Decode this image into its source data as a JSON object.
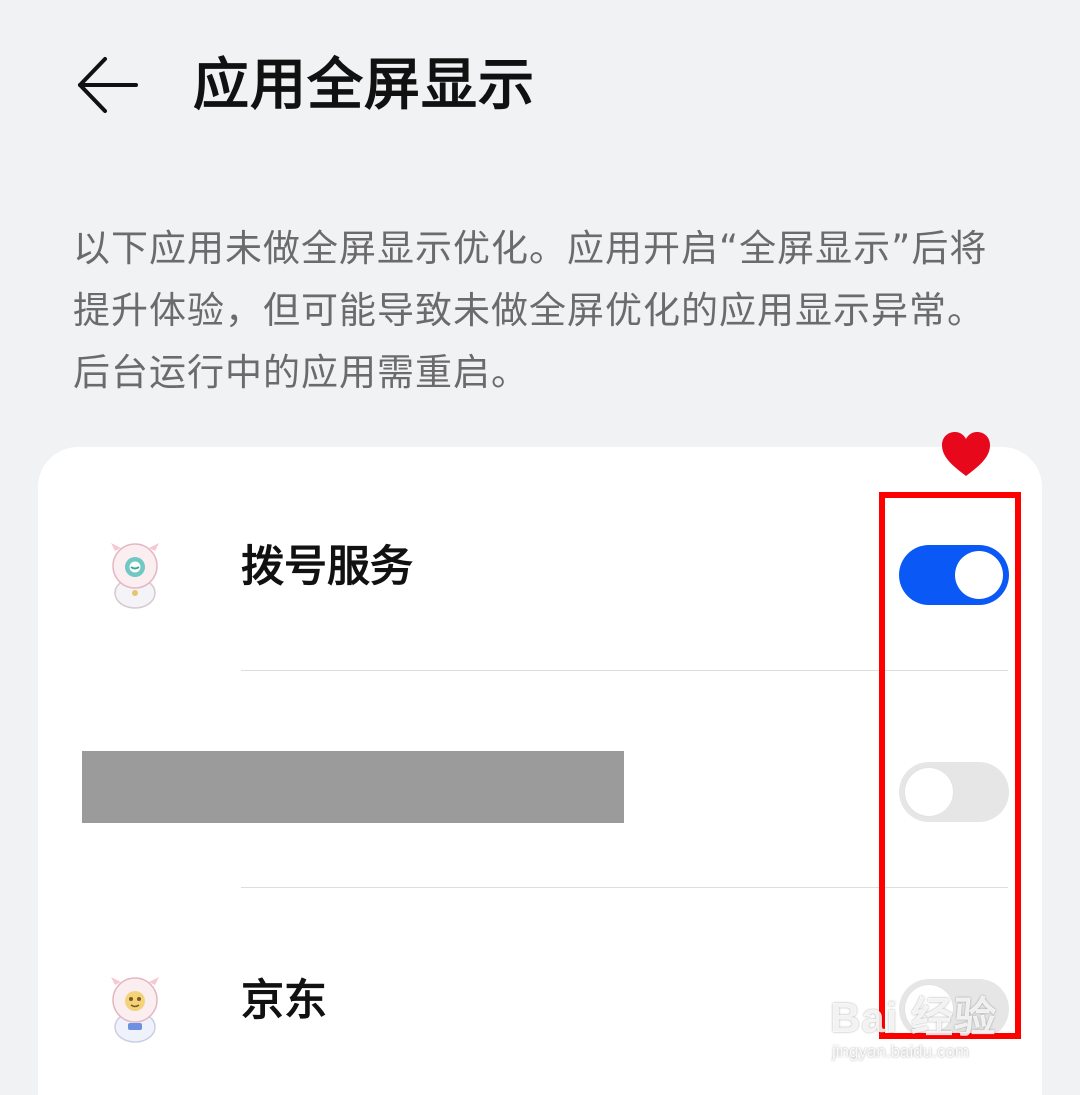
{
  "header": {
    "title": "应用全屏显示",
    "back_icon": "arrow-left-icon"
  },
  "description": "以下应用未做全屏显示优化。应用开启“全屏显示”后将提升体验，但可能导致未做全屏优化的应用显示异常。后台运行中的应用需重启。",
  "apps": [
    {
      "name": "拨号服务",
      "icon": "app-icon-dialer",
      "fullscreen_enabled": true
    },
    {
      "name": "",
      "icon": "redacted-block",
      "fullscreen_enabled": false
    },
    {
      "name": "京东",
      "icon": "app-icon-jd",
      "fullscreen_enabled": false
    }
  ],
  "annotation": {
    "box_color": "#ff0000",
    "marker_icon": "heart-icon"
  },
  "watermark": {
    "logo": "Bai 经验",
    "url": "jingyan.baidu.com"
  },
  "colors": {
    "toggle_on": "#0a59f7",
    "toggle_off": "#e6e6e6",
    "background": "#f1f2f4"
  }
}
